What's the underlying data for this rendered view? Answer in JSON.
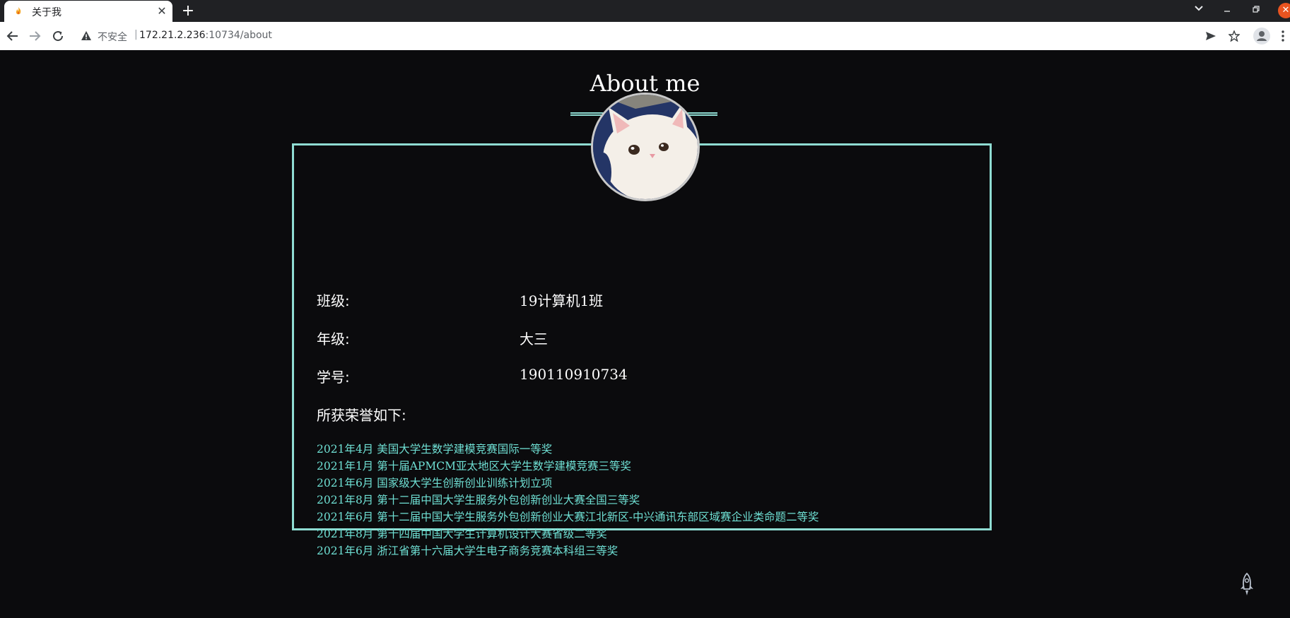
{
  "browser": {
    "tab_title": "关于我",
    "tab_close": "✕",
    "new_tab": "+",
    "insecure_label": "不安全",
    "url_separator": "|",
    "url_host": "172.21.2.236",
    "url_rest": ":10734/about",
    "icons": {
      "back": "back-arrow-icon",
      "forward": "forward-arrow-icon",
      "reload": "reload-icon",
      "warning": "warning-icon",
      "send": "send-icon",
      "bookmark": "star-icon",
      "profile": "profile-icon",
      "menu": "menu-dots-icon"
    }
  },
  "page": {
    "title": "About me",
    "accent_color": "#8fdcd2",
    "info": [
      {
        "label": "班级:",
        "value": "19计算机1班"
      },
      {
        "label": "年级:",
        "value": "大三"
      },
      {
        "label": "学号:",
        "value": "190110910734"
      }
    ],
    "honors_title": "所获荣誉如下:",
    "honors": [
      "2021年4月 美国大学生数学建模竞赛国际一等奖",
      "2021年1月 第十届APMCM亚太地区大学生数学建模竞赛三等奖",
      "2021年6月 国家级大学生创新创业训练计划立项",
      "2021年8月 第十二届中国大学生服务外包创新创业大赛全国三等奖",
      "2021年6月 第十二届中国大学生服务外包创新创业大赛江北新区-中兴通讯东部区域赛企业类命题二等奖",
      "2021年8月 第十四届中国大学生计算机设计大赛省级二等奖",
      "2021年6月 浙江省第十六届大学生电子商务竞赛本科组三等奖"
    ]
  }
}
